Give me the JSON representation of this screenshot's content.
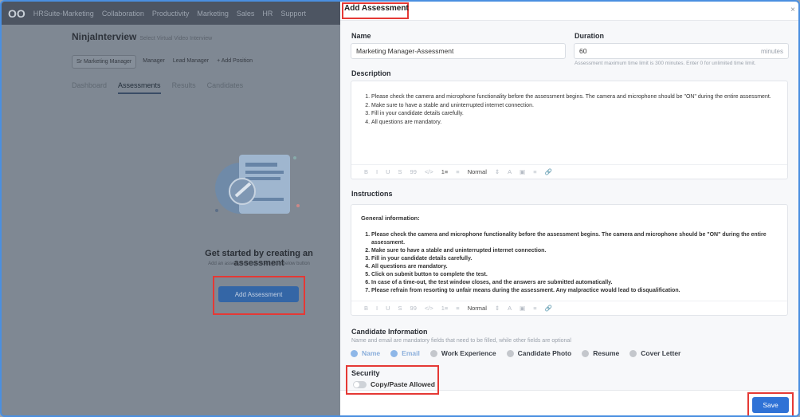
{
  "topnav": {
    "logo": "OO",
    "items": [
      "HRSuite-Marketing",
      "Collaboration",
      "Productivity",
      "Marketing",
      "Sales",
      "HR",
      "Support"
    ]
  },
  "app": {
    "title": "NinjaInterview",
    "subtitle": "Select Virtual Video Interview",
    "roles": [
      "Sr Marketing Manager",
      "Manager",
      "Lead Manager",
      "+ Add Position"
    ],
    "tabs": [
      "Dashboard",
      "Assessments",
      "Results",
      "Candidates"
    ],
    "active_tab": "Assessments",
    "empty_title": "Get started by creating an assessment",
    "empty_subtitle": "Add an assessment by clicking the below button",
    "add_button": "Add Assessment"
  },
  "modal": {
    "title": "Add Assessment",
    "close": "×",
    "name_label": "Name",
    "name_value": "Marketing Manager-Assessment",
    "duration_label": "Duration",
    "duration_value": "60",
    "duration_unit": "minutes",
    "duration_hint": "Assessment maximum time limit is 300 minutes. Enter 0 for unlimited time limit.",
    "description_label": "Description",
    "description_items": [
      "Please check the camera and microphone functionality before the assessment begins. The camera and microphone should be \"ON\" during the entire assessment.",
      "Make sure to have a stable and uninterrupted internet connection.",
      "Fill in your candidate details carefully.",
      "All questions are mandatory."
    ],
    "instructions_label": "Instructions",
    "instructions_heading": "General information:",
    "instructions_items": [
      "Please check the camera and microphone functionality before the assessment begins. The camera and microphone should be \"ON\" during the entire assessment.",
      "Make sure to have a stable and uninterrupted internet connection.",
      "Fill in your candidate details carefully.",
      "All questions are mandatory.",
      "Click on submit button to complete the test.",
      "In case of a time-out, the test window closes, and the answers are submitted automatically.",
      "Please refrain from resorting to unfair means during the assessment. Any malpractice would lead to disqualification."
    ],
    "toolbar": {
      "bold": "B",
      "italic": "I",
      "underline": "U",
      "strike": "S",
      "quote": "99",
      "code": "</>",
      "ordered": "1≡",
      "bullet": "≡",
      "format": "Normal",
      "updown": "⇕",
      "color": "A",
      "bg": "▣",
      "align": "≡",
      "link": "🔗"
    },
    "candidate_label": "Candidate Information",
    "candidate_hint": "Name and email are mandatory fields that need to be filled, while other fields are optional",
    "candidate_fields": [
      {
        "label": "Name",
        "checked": true
      },
      {
        "label": "Email",
        "checked": true
      },
      {
        "label": "Work Experience",
        "checked": false
      },
      {
        "label": "Candidate Photo",
        "checked": false
      },
      {
        "label": "Resume",
        "checked": false
      },
      {
        "label": "Cover Letter",
        "checked": false
      }
    ],
    "security_label": "Security",
    "copy_paste_label": "Copy/Paste Allowed",
    "copy_paste_enabled": false,
    "save": "Save"
  }
}
